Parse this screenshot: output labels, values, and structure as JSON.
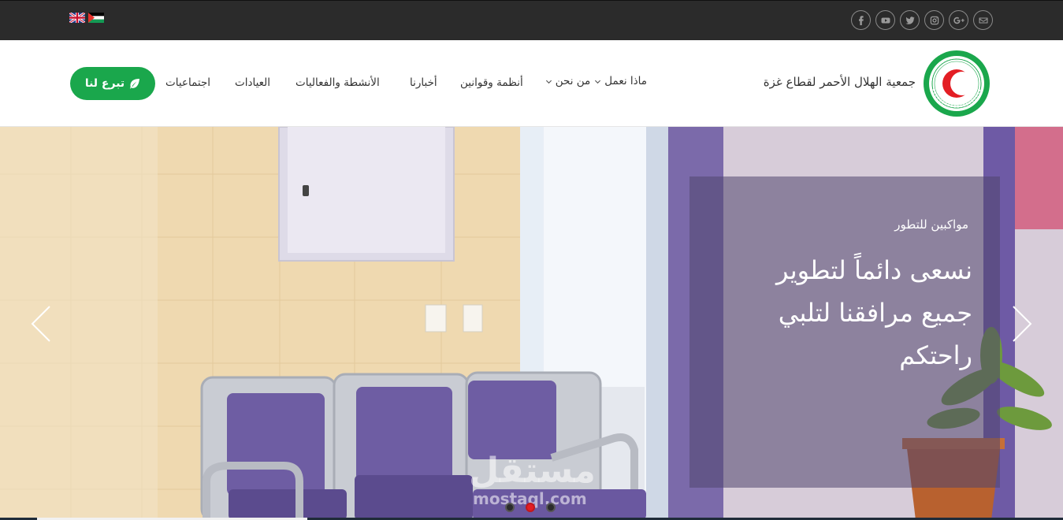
{
  "topbar": {
    "flags": [
      {
        "name": "english-flag-icon",
        "label": "English"
      },
      {
        "name": "palestine-flag-icon",
        "label": "Arabic"
      }
    ],
    "socials": [
      "facebook-icon",
      "youtube-icon",
      "twitter-icon",
      "instagram-icon",
      "google-plus-icon",
      "email-icon"
    ]
  },
  "header": {
    "org_name": "جمعية الهلال الأحمر لقطاع غزة",
    "nav": [
      {
        "label": "من نحن",
        "has_dropdown": true
      },
      {
        "label": "ماذا نعمل",
        "has_dropdown": true
      },
      {
        "label": "أنظمة وقوانين",
        "has_dropdown": false
      },
      {
        "label": "أخبارنا",
        "has_dropdown": false
      },
      {
        "label": "الأنشطة والفعاليات",
        "has_dropdown": false
      },
      {
        "label": "العيادات",
        "has_dropdown": false
      },
      {
        "label": "اجتماعيات",
        "has_dropdown": false
      }
    ],
    "donate_label": "تبرع لنا"
  },
  "hero": {
    "subtitle": "مواكبين للتطور",
    "title": "نسعى دائماً لتطوير جميع مرافقنا لتلبي راحتكم",
    "watermark": "مستقل",
    "watermark_sub": "mostaql.com",
    "slides_count": 3,
    "active_slide": 2
  },
  "colors": {
    "topbar": "#2b2b2b",
    "accent_green": "#1aa74c",
    "crescent_red": "#e31e24"
  }
}
